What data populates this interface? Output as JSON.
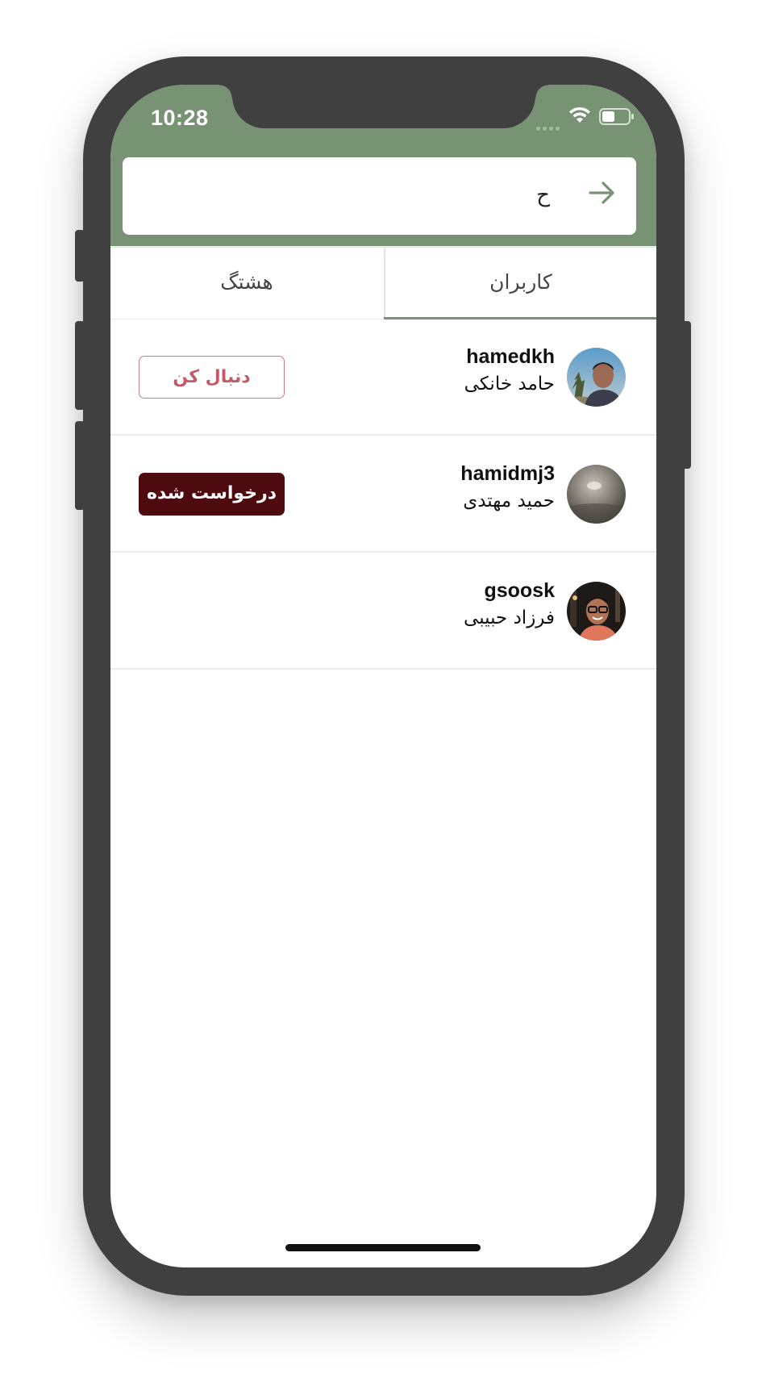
{
  "status_bar": {
    "time": "10:28"
  },
  "search": {
    "value": "ح"
  },
  "tabs": [
    {
      "label": "کاربران",
      "active": true
    },
    {
      "label": "هشتگ",
      "active": false
    }
  ],
  "users": [
    {
      "username": "hamedkh",
      "fullname": "حامد خانکی",
      "action": "دنبال کن",
      "action_style": "outline"
    },
    {
      "username": "hamidmj3",
      "fullname": "حمید مهتدی",
      "action": "درخواست شده",
      "action_style": "filled"
    },
    {
      "username": "gsoosk",
      "fullname": "فرزاد حبیبی",
      "action": null,
      "action_style": null
    }
  ],
  "colors": {
    "header": "#789274",
    "follow_button": "#c25a6a",
    "requested_button": "#4e0b0f",
    "phone_frame": "#404040"
  },
  "icons": [
    "arrow-right-icon",
    "wifi-icon",
    "battery-icon",
    "signal-icon"
  ]
}
